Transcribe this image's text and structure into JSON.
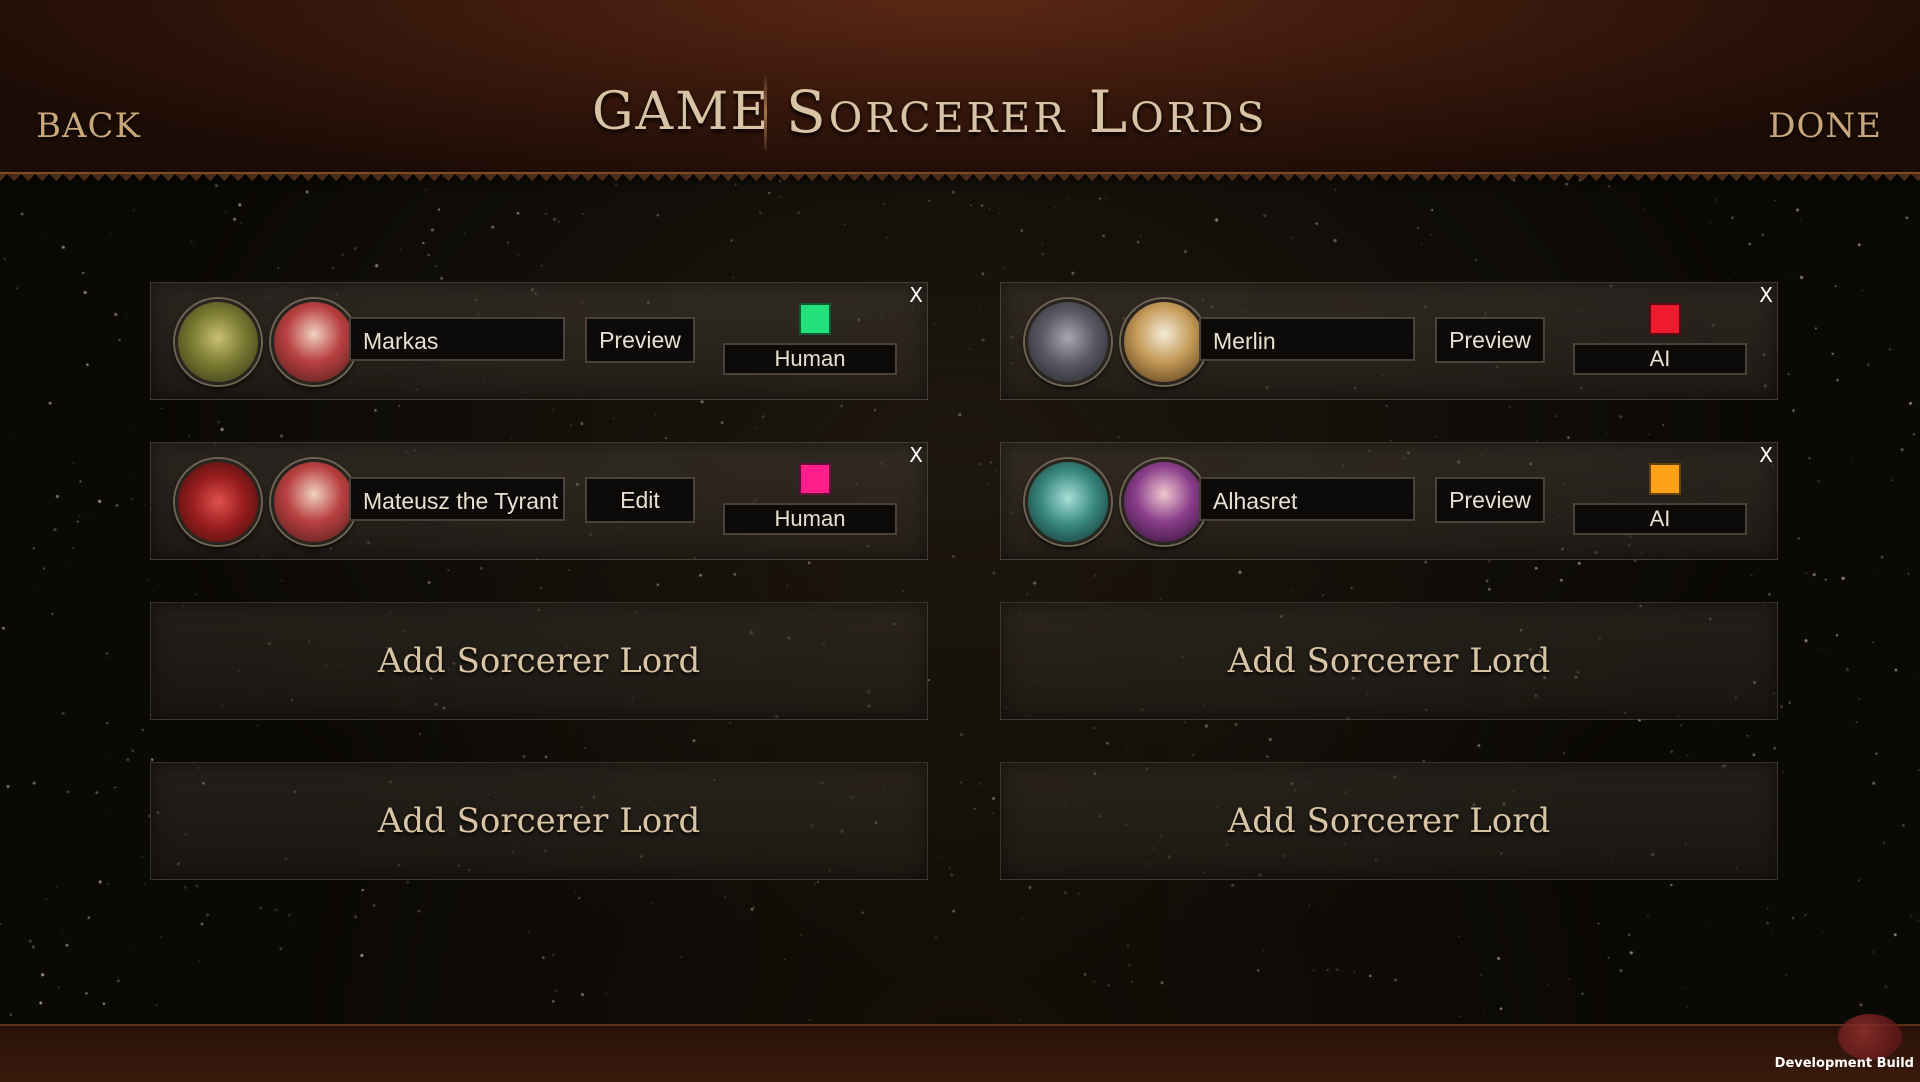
{
  "header": {
    "back_label": "BACK",
    "game_label": "GAME",
    "title": "Sorcerer Lords",
    "done_label": "DONE"
  },
  "players": [
    {
      "name": "Markas",
      "action": "Preview",
      "type": "Human",
      "color": "#22e07a"
    },
    {
      "name": "Merlin",
      "action": "Preview",
      "type": "AI",
      "color": "#ee1a2e"
    },
    {
      "name": "Mateusz the Tyrant",
      "action": "Edit",
      "type": "Human",
      "color": "#ff1e8a"
    },
    {
      "name": "Alhasret",
      "action": "Preview",
      "type": "AI",
      "color": "#ffa21a"
    }
  ],
  "close_label": "X",
  "add_slots": [
    "Add Sorcerer Lord",
    "Add Sorcerer Lord",
    "Add Sorcerer Lord",
    "Add Sorcerer Lord"
  ],
  "footer": {
    "build_label": "Development Build"
  },
  "icons": [
    "banner-icon",
    "portrait-icon",
    "close-icon",
    "playground-logo"
  ]
}
